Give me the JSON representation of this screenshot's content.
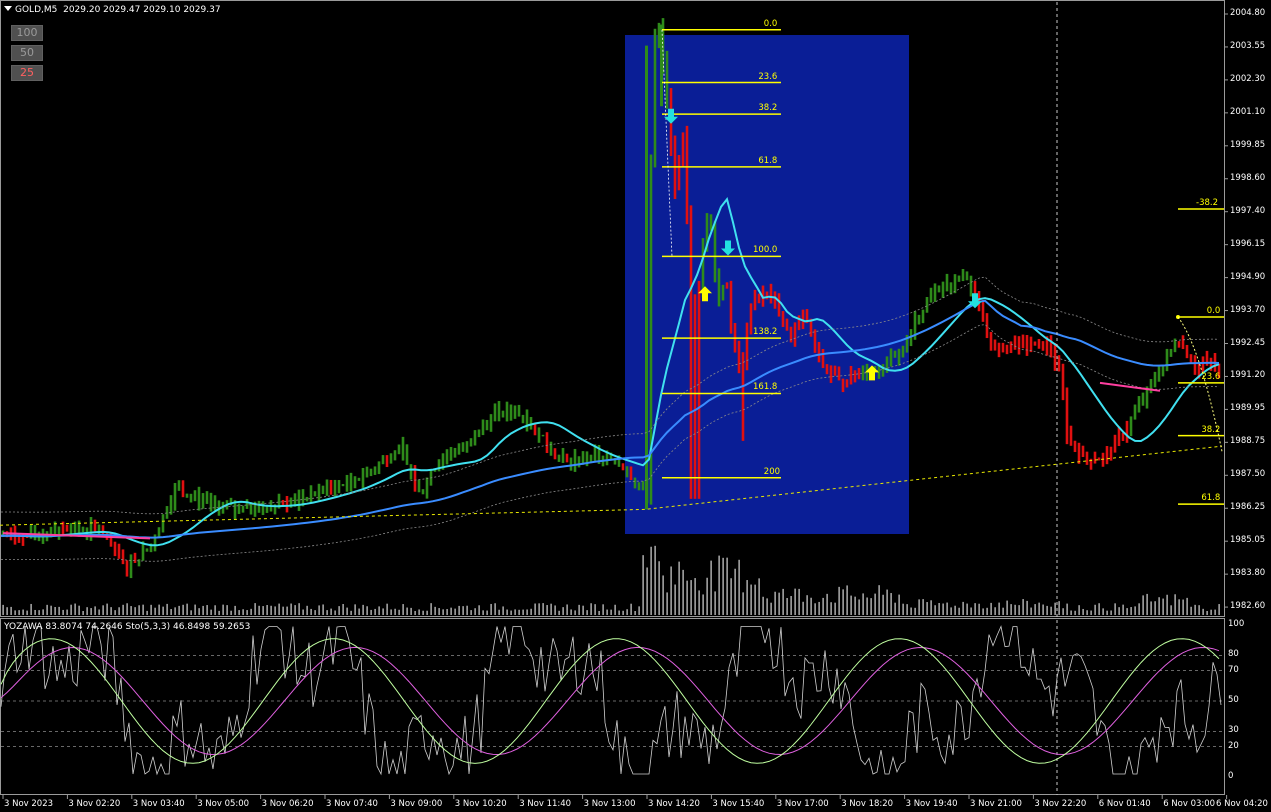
{
  "header": {
    "symbol": "GOLD,M5",
    "ohlc": "2029.20 2029.47 2029.10 2029.37"
  },
  "zoom_buttons": [
    {
      "label": "100",
      "color": "#9a9a9a"
    },
    {
      "label": "50",
      "color": "#9a9a9a"
    },
    {
      "label": "25",
      "color": "#ff6060"
    }
  ],
  "indicator_header": "YOZAWA 83.8074 74.2646  Sto(5,3,3) 46.8498 59.2653",
  "price_axis": [
    "2004.80",
    "2003.55",
    "2002.30",
    "2001.10",
    "1999.85",
    "1998.60",
    "1997.40",
    "1996.15",
    "1994.90",
    "1993.70",
    "1992.45",
    "1991.20",
    "1989.95",
    "1988.75",
    "1987.50",
    "1986.25",
    "1985.05",
    "1983.80",
    "1982.60"
  ],
  "osc_axis": [
    "100",
    "80",
    "70",
    "50",
    "30",
    "20",
    "0"
  ],
  "time_axis": [
    "3 Nov 2023",
    "3 Nov 02:20",
    "3 Nov 03:40",
    "3 Nov 05:00",
    "3 Nov 06:20",
    "3 Nov 07:40",
    "3 Nov 09:00",
    "3 Nov 10:20",
    "3 Nov 11:40",
    "3 Nov 13:00",
    "3 Nov 14:20",
    "3 Nov 15:40",
    "3 Nov 17:00",
    "3 Nov 18:20",
    "3 Nov 19:40",
    "3 Nov 21:00",
    "3 Nov 22:20",
    "6 Nov 01:40",
    "6 Nov 03:00",
    "6 Nov 04:20"
  ],
  "fib_main": [
    "0.0",
    "23.6",
    "38.2",
    "61.8",
    "100.0",
    "138.2",
    "161.8",
    "200"
  ],
  "fib_right": [
    "-38.2",
    "0.0",
    "23.6",
    "38.2",
    "61.8"
  ],
  "colors": {
    "bull": "#2e8b1a",
    "bear": "#e01010",
    "fib": "#ffff00",
    "zone": "#0a1e96",
    "ma_fast": "#40e0f0",
    "ma_slow": "#3a8cff",
    "stoch_main": "#c0ffa0",
    "stoch_signal": "#e060e0"
  }
}
